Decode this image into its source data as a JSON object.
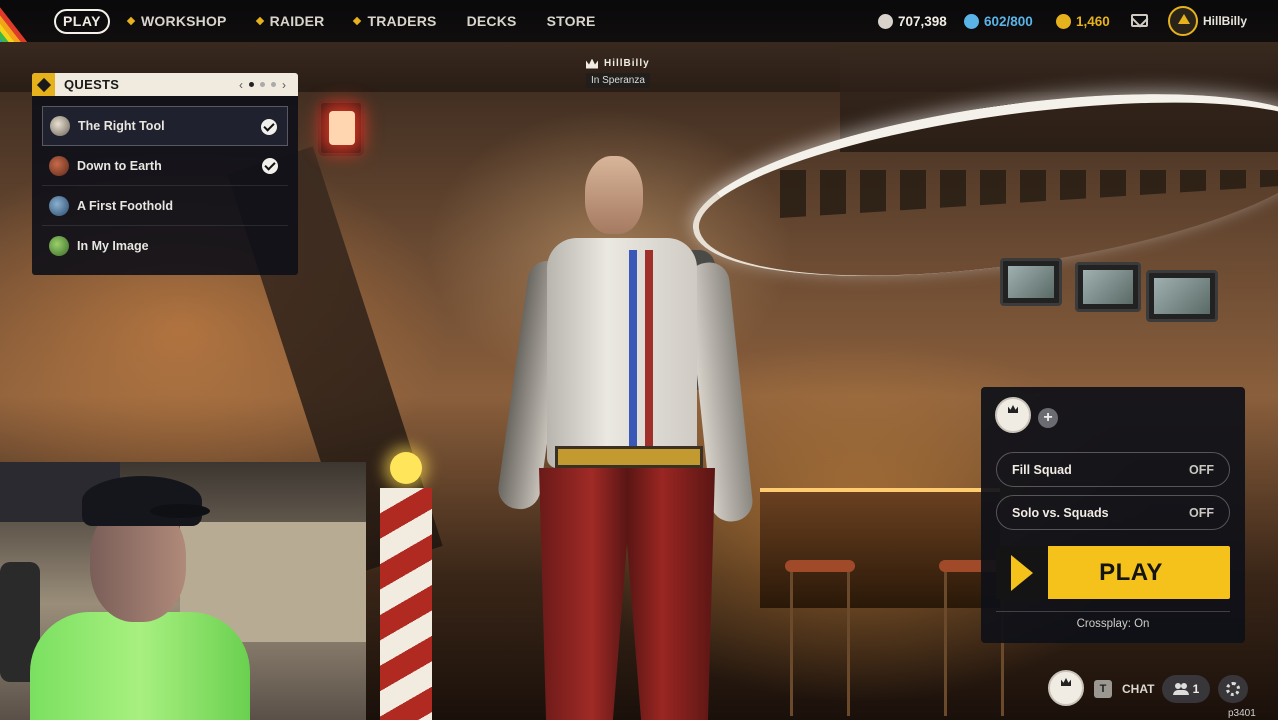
{
  "nav": {
    "play_label": "PLAY",
    "items": [
      {
        "label": "WORKSHOP",
        "icon": "diamond-icon"
      },
      {
        "label": "RAIDER",
        "icon": "diamond-icon"
      },
      {
        "label": "TRADERS",
        "icon": "diamond-icon"
      },
      {
        "label": "DECKS",
        "icon": ""
      },
      {
        "label": "STORE",
        "icon": ""
      }
    ],
    "currencies": [
      {
        "value": "707,398",
        "icon": "coin-icon",
        "color": "#d8d4cc"
      },
      {
        "value": "602/800",
        "icon": "token-icon",
        "color": "#5ab4e8"
      },
      {
        "value": "1,460",
        "icon": "cred-icon",
        "color": "#e5b21e"
      }
    ],
    "username": "HillBilly"
  },
  "quests": {
    "title": "QUESTS",
    "pager": {
      "prev": "‹",
      "next": "›",
      "pages": 3,
      "current": 2
    },
    "items": [
      {
        "name": "The Right Tool",
        "completed": true
      },
      {
        "name": "Down to Earth",
        "completed": true
      },
      {
        "name": "A First Foothold",
        "completed": false
      },
      {
        "name": "In My Image",
        "completed": false
      }
    ]
  },
  "player_tag": {
    "name": "HillBilly",
    "location": "In Speranza"
  },
  "play_panel": {
    "add_symbol": "+",
    "fill_squad": {
      "label": "Fill Squad",
      "value": "OFF"
    },
    "solo_vs_squads": {
      "label": "Solo vs. Squads",
      "value": "OFF"
    },
    "play_label": "PLAY",
    "crossplay": "Crossplay: On"
  },
  "bottom_bar": {
    "chat_key": "T",
    "chat_label": "CHAT",
    "friends_count": "1",
    "build": "p3401"
  },
  "colors": {
    "accent": "#f4c21a",
    "panel_bg": "#0e1018"
  }
}
